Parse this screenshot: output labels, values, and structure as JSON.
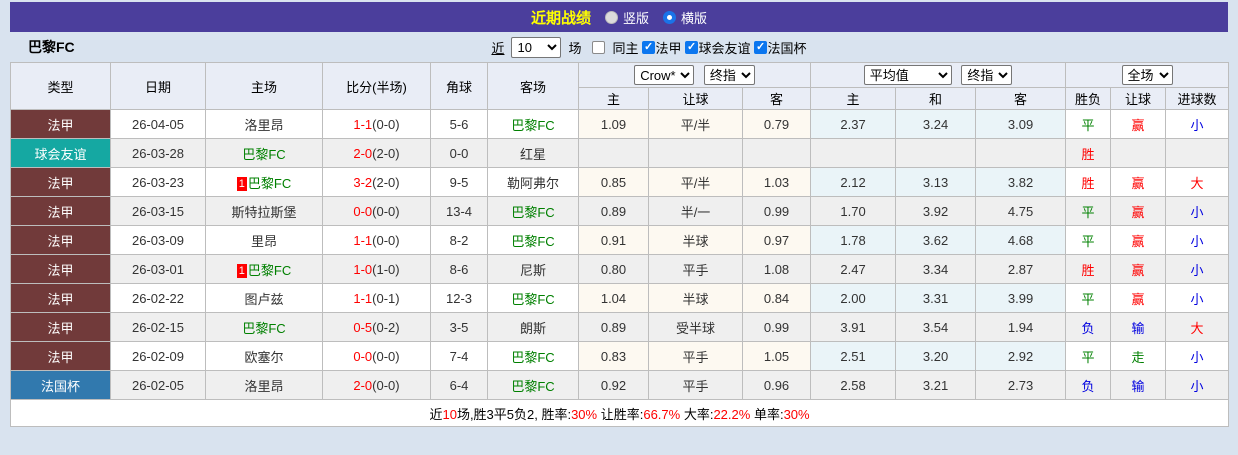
{
  "title_bar": {
    "title": "近期战绩",
    "radio_vertical": "竖版",
    "radio_horizontal": "横版"
  },
  "filter_bar": {
    "team": "巴黎FC",
    "near_label": "近",
    "matches_count": "10",
    "matches_label": "场",
    "same_home": {
      "label": "同主",
      "checked": false
    },
    "league_filters": [
      {
        "label": "法甲",
        "checked": true
      },
      {
        "label": "球会友谊",
        "checked": true
      },
      {
        "label": "法国杯",
        "checked": true
      }
    ]
  },
  "table": {
    "headers": {
      "type": "类型",
      "date": "日期",
      "home": "主场",
      "score": "比分(半场)",
      "corner": "角球",
      "away": "客场",
      "group1": {
        "select1": "Crow*",
        "select2": "终指",
        "cols": [
          "主",
          "让球",
          "客"
        ]
      },
      "group2": {
        "select1": "平均值",
        "select2": "终指",
        "cols": [
          "主",
          "和",
          "客"
        ]
      },
      "group3": {
        "select1": "全场",
        "cols": [
          "胜负",
          "让球",
          "进球数"
        ]
      }
    },
    "rows": [
      {
        "type": "法甲",
        "type_color": "#713a3a",
        "date": "26-04-05",
        "home": {
          "name": "洛里昂",
          "green": false,
          "rank": ""
        },
        "score": {
          "ft": "1-1",
          "ht": "(0-0)"
        },
        "corner": "5-6",
        "away": {
          "name": "巴黎FC",
          "green": true
        },
        "handicap": [
          "1.09",
          "平/半",
          "0.79"
        ],
        "average": [
          "2.37",
          "3.24",
          "3.09"
        ],
        "results": [
          {
            "t": "平",
            "c": "#008000"
          },
          {
            "t": "赢",
            "c": "#ff0000"
          },
          {
            "t": "小",
            "c": "#0000e0"
          }
        ]
      },
      {
        "type": "球会友谊",
        "type_color": "#15a8a2",
        "date": "26-03-28",
        "home": {
          "name": "巴黎FC",
          "green": true,
          "rank": ""
        },
        "score": {
          "ft": "2-0",
          "ht": "(2-0)"
        },
        "corner": "0-0",
        "away": {
          "name": "红星",
          "green": false
        },
        "handicap": [
          "",
          "",
          ""
        ],
        "average": [
          "",
          "",
          ""
        ],
        "results": [
          {
            "t": "胜",
            "c": "#ff0000"
          },
          {
            "t": "",
            "c": ""
          },
          {
            "t": "",
            "c": ""
          }
        ]
      },
      {
        "type": "法甲",
        "type_color": "#713a3a",
        "date": "26-03-23",
        "home": {
          "name": "巴黎FC",
          "green": true,
          "rank": "1"
        },
        "score": {
          "ft": "3-2",
          "ht": "(2-0)"
        },
        "corner": "9-5",
        "away": {
          "name": "勒阿弗尔",
          "green": false
        },
        "handicap": [
          "0.85",
          "平/半",
          "1.03"
        ],
        "average": [
          "2.12",
          "3.13",
          "3.82"
        ],
        "results": [
          {
            "t": "胜",
            "c": "#ff0000"
          },
          {
            "t": "赢",
            "c": "#ff0000"
          },
          {
            "t": "大",
            "c": "#ff0000"
          }
        ]
      },
      {
        "type": "法甲",
        "type_color": "#713a3a",
        "date": "26-03-15",
        "home": {
          "name": "斯特拉斯堡",
          "green": false,
          "rank": ""
        },
        "score": {
          "ft": "0-0",
          "ht": "(0-0)"
        },
        "corner": "13-4",
        "away": {
          "name": "巴黎FC",
          "green": true
        },
        "handicap": [
          "0.89",
          "半/一",
          "0.99"
        ],
        "average": [
          "1.70",
          "3.92",
          "4.75"
        ],
        "results": [
          {
            "t": "平",
            "c": "#008000"
          },
          {
            "t": "赢",
            "c": "#ff0000"
          },
          {
            "t": "小",
            "c": "#0000e0"
          }
        ]
      },
      {
        "type": "法甲",
        "type_color": "#713a3a",
        "date": "26-03-09",
        "home": {
          "name": "里昂",
          "green": false,
          "rank": ""
        },
        "score": {
          "ft": "1-1",
          "ht": "(0-0)"
        },
        "corner": "8-2",
        "away": {
          "name": "巴黎FC",
          "green": true
        },
        "handicap": [
          "0.91",
          "半球",
          "0.97"
        ],
        "average": [
          "1.78",
          "3.62",
          "4.68"
        ],
        "results": [
          {
            "t": "平",
            "c": "#008000"
          },
          {
            "t": "赢",
            "c": "#ff0000"
          },
          {
            "t": "小",
            "c": "#0000e0"
          }
        ]
      },
      {
        "type": "法甲",
        "type_color": "#713a3a",
        "date": "26-03-01",
        "home": {
          "name": "巴黎FC",
          "green": true,
          "rank": "1"
        },
        "score": {
          "ft": "1-0",
          "ht": "(1-0)"
        },
        "corner": "8-6",
        "away": {
          "name": "尼斯",
          "green": false
        },
        "handicap": [
          "0.80",
          "平手",
          "1.08"
        ],
        "average": [
          "2.47",
          "3.34",
          "2.87"
        ],
        "results": [
          {
            "t": "胜",
            "c": "#ff0000"
          },
          {
            "t": "赢",
            "c": "#ff0000"
          },
          {
            "t": "小",
            "c": "#0000e0"
          }
        ]
      },
      {
        "type": "法甲",
        "type_color": "#713a3a",
        "date": "26-02-22",
        "home": {
          "name": "图卢兹",
          "green": false,
          "rank": ""
        },
        "score": {
          "ft": "1-1",
          "ht": "(0-1)"
        },
        "corner": "12-3",
        "away": {
          "name": "巴黎FC",
          "green": true
        },
        "handicap": [
          "1.04",
          "半球",
          "0.84"
        ],
        "average": [
          "2.00",
          "3.31",
          "3.99"
        ],
        "results": [
          {
            "t": "平",
            "c": "#008000"
          },
          {
            "t": "赢",
            "c": "#ff0000"
          },
          {
            "t": "小",
            "c": "#0000e0"
          }
        ]
      },
      {
        "type": "法甲",
        "type_color": "#713a3a",
        "date": "26-02-15",
        "home": {
          "name": "巴黎FC",
          "green": true,
          "rank": ""
        },
        "score": {
          "ft": "0-5",
          "ht": "(0-2)"
        },
        "corner": "3-5",
        "away": {
          "name": "朗斯",
          "green": false
        },
        "handicap": [
          "0.89",
          "受半球",
          "0.99"
        ],
        "average": [
          "3.91",
          "3.54",
          "1.94"
        ],
        "results": [
          {
            "t": "负",
            "c": "#0000e0"
          },
          {
            "t": "输",
            "c": "#0000e0"
          },
          {
            "t": "大",
            "c": "#ff0000"
          }
        ]
      },
      {
        "type": "法甲",
        "type_color": "#713a3a",
        "date": "26-02-09",
        "home": {
          "name": "欧塞尔",
          "green": false,
          "rank": ""
        },
        "score": {
          "ft": "0-0",
          "ht": "(0-0)"
        },
        "corner": "7-4",
        "away": {
          "name": "巴黎FC",
          "green": true
        },
        "handicap": [
          "0.83",
          "平手",
          "1.05"
        ],
        "average": [
          "2.51",
          "3.20",
          "2.92"
        ],
        "results": [
          {
            "t": "平",
            "c": "#008000"
          },
          {
            "t": "走",
            "c": "#008000"
          },
          {
            "t": "小",
            "c": "#0000e0"
          }
        ]
      },
      {
        "type": "法国杯",
        "type_color": "#3179ae",
        "date": "26-02-05",
        "home": {
          "name": "洛里昂",
          "green": false,
          "rank": ""
        },
        "score": {
          "ft": "2-0",
          "ht": "(0-0)"
        },
        "corner": "6-4",
        "away": {
          "name": "巴黎FC",
          "green": true
        },
        "handicap": [
          "0.92",
          "平手",
          "0.96"
        ],
        "average": [
          "2.58",
          "3.21",
          "2.73"
        ],
        "results": [
          {
            "t": "负",
            "c": "#0000e0"
          },
          {
            "t": "输",
            "c": "#0000e0"
          },
          {
            "t": "小",
            "c": "#0000e0"
          }
        ]
      }
    ]
  },
  "summary": {
    "segments": [
      {
        "t": "近",
        "red": false
      },
      {
        "t": "10",
        "red": true
      },
      {
        "t": "场,胜3平5负2, 胜率:",
        "red": false
      },
      {
        "t": "30%",
        "red": true
      },
      {
        "t": " 让胜率:",
        "red": false
      },
      {
        "t": "66.7%",
        "red": true
      },
      {
        "t": " 大率:",
        "red": false
      },
      {
        "t": "22.2%",
        "red": true
      },
      {
        "t": " 单率:",
        "red": false
      },
      {
        "t": "30%",
        "red": true
      }
    ]
  },
  "colors": {
    "titlebar_bg": "#4b3e9c",
    "title_text": "#ffff00",
    "page_bg": "#d9e3ef",
    "ligue1_badge": "#713a3a",
    "friendly_badge": "#15a8a2",
    "cup_badge": "#3179ae",
    "team_green": "#008000",
    "red": "#ff0000",
    "blue": "#0000e0",
    "green": "#008000",
    "handicap_col_bg": "#fdf9f1",
    "average_col_bg": "#eaf4f8"
  }
}
